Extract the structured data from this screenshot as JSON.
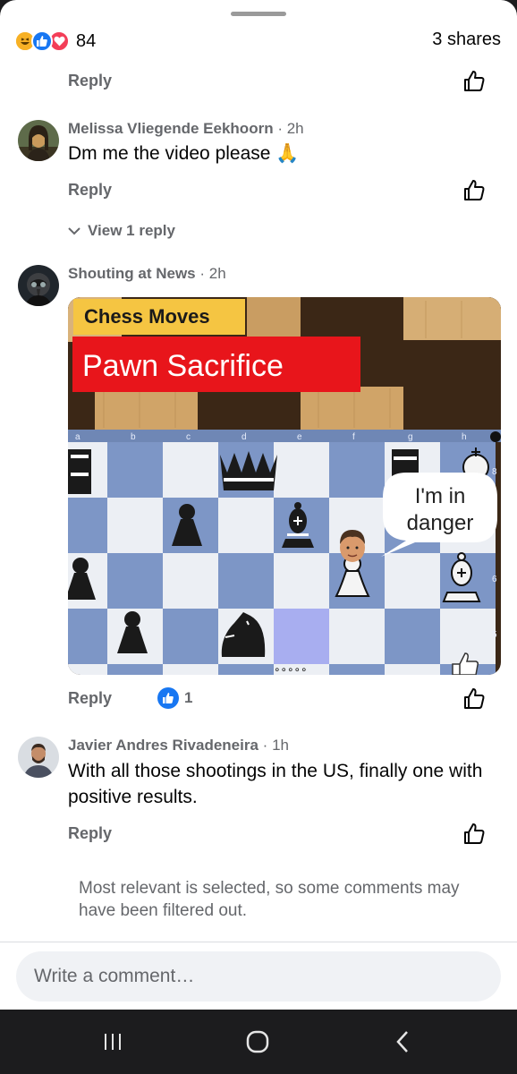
{
  "header": {
    "reaction_icons": [
      "haha-icon",
      "like-icon",
      "love-icon"
    ],
    "reaction_count": "84",
    "shares": "3 shares"
  },
  "reply_label": "Reply",
  "comments": [
    {
      "author": "Melissa Vliegende Eekhoorn",
      "time": "2h",
      "text": "Dm me the video please 🙏"
    },
    {
      "author": "Shouting at News",
      "time": "2h",
      "image": {
        "tag": "Chess Moves",
        "title": "Pawn Sacrifice",
        "bubble": "I'm in danger",
        "files": [
          "a",
          "b",
          "c",
          "d",
          "e",
          "f",
          "g",
          "h"
        ],
        "ranks": [
          "8",
          "6",
          "5"
        ]
      },
      "like_count": "1"
    },
    {
      "author": "Javier Andres Rivadeneira",
      "time": "1h",
      "text": "With all those shootings in the US, finally one with positive results."
    }
  ],
  "view_reply": "View 1 reply",
  "time_separator": "·",
  "filter_note": "Most relevant is selected, so some comments may have been filtered out.",
  "composer": {
    "placeholder": "Write a comment…"
  },
  "colors": {
    "accent": "#1877f2",
    "secondary_text": "#65676b",
    "love": "#f33e58",
    "haha": "#f7b125",
    "banner_red": "#e8151b",
    "tag_yellow": "#f5c542"
  },
  "icons": {
    "like": "thumbs-up-outline-icon",
    "chevron": "chevron-down-icon",
    "nav": [
      "recents-icon",
      "home-icon",
      "back-icon"
    ]
  }
}
